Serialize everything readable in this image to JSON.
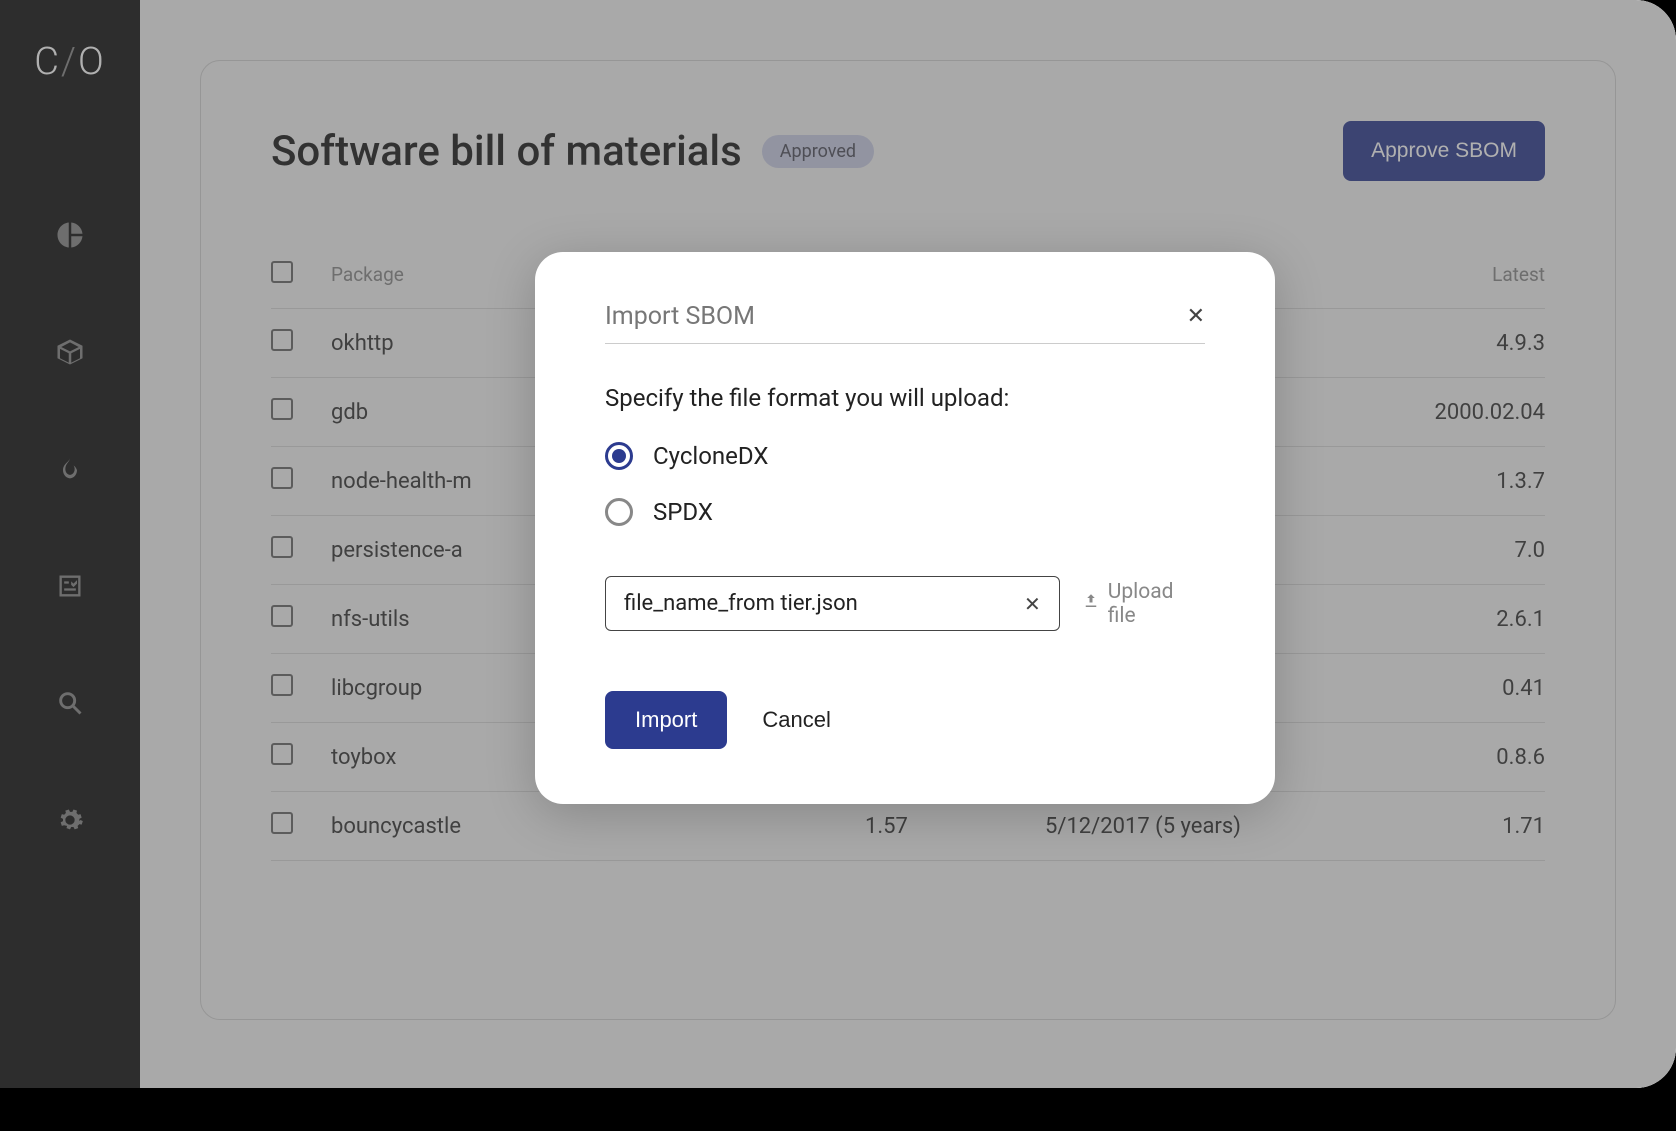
{
  "page": {
    "title": "Software bill of materials",
    "status": "Approved",
    "approve_button": "Approve SBOM"
  },
  "table": {
    "headers": {
      "package": "Package",
      "latest": "Latest"
    },
    "rows": [
      {
        "package": "okhttp",
        "version": "",
        "date": "",
        "latest": "4.9.3"
      },
      {
        "package": "gdb",
        "version": "",
        "date": "",
        "latest": "2000.02.04"
      },
      {
        "package": "node-health-m",
        "version": "",
        "date": "",
        "latest": "1.3.7"
      },
      {
        "package": "persistence-a",
        "version": "",
        "date": "",
        "latest": "7.0"
      },
      {
        "package": "nfs-utils",
        "version": "",
        "date": "",
        "latest": "2.6.1"
      },
      {
        "package": "libcgroup",
        "version": "",
        "date": "",
        "latest": "0.41"
      },
      {
        "package": "toybox",
        "version": "",
        "date": "",
        "latest": "0.8.6"
      },
      {
        "package": "bouncycastle",
        "version": "1.57",
        "date": "5/12/2017 (5 years)",
        "latest": "1.71"
      }
    ]
  },
  "modal": {
    "title": "Import SBOM",
    "prompt": "Specify the file format you will upload:",
    "format_options": [
      {
        "label": "CycloneDX",
        "selected": true
      },
      {
        "label": "SPDX",
        "selected": false
      }
    ],
    "file_name": "file_name_from tier.json",
    "upload_label": "Upload file",
    "import_button": "Import",
    "cancel_button": "Cancel"
  }
}
